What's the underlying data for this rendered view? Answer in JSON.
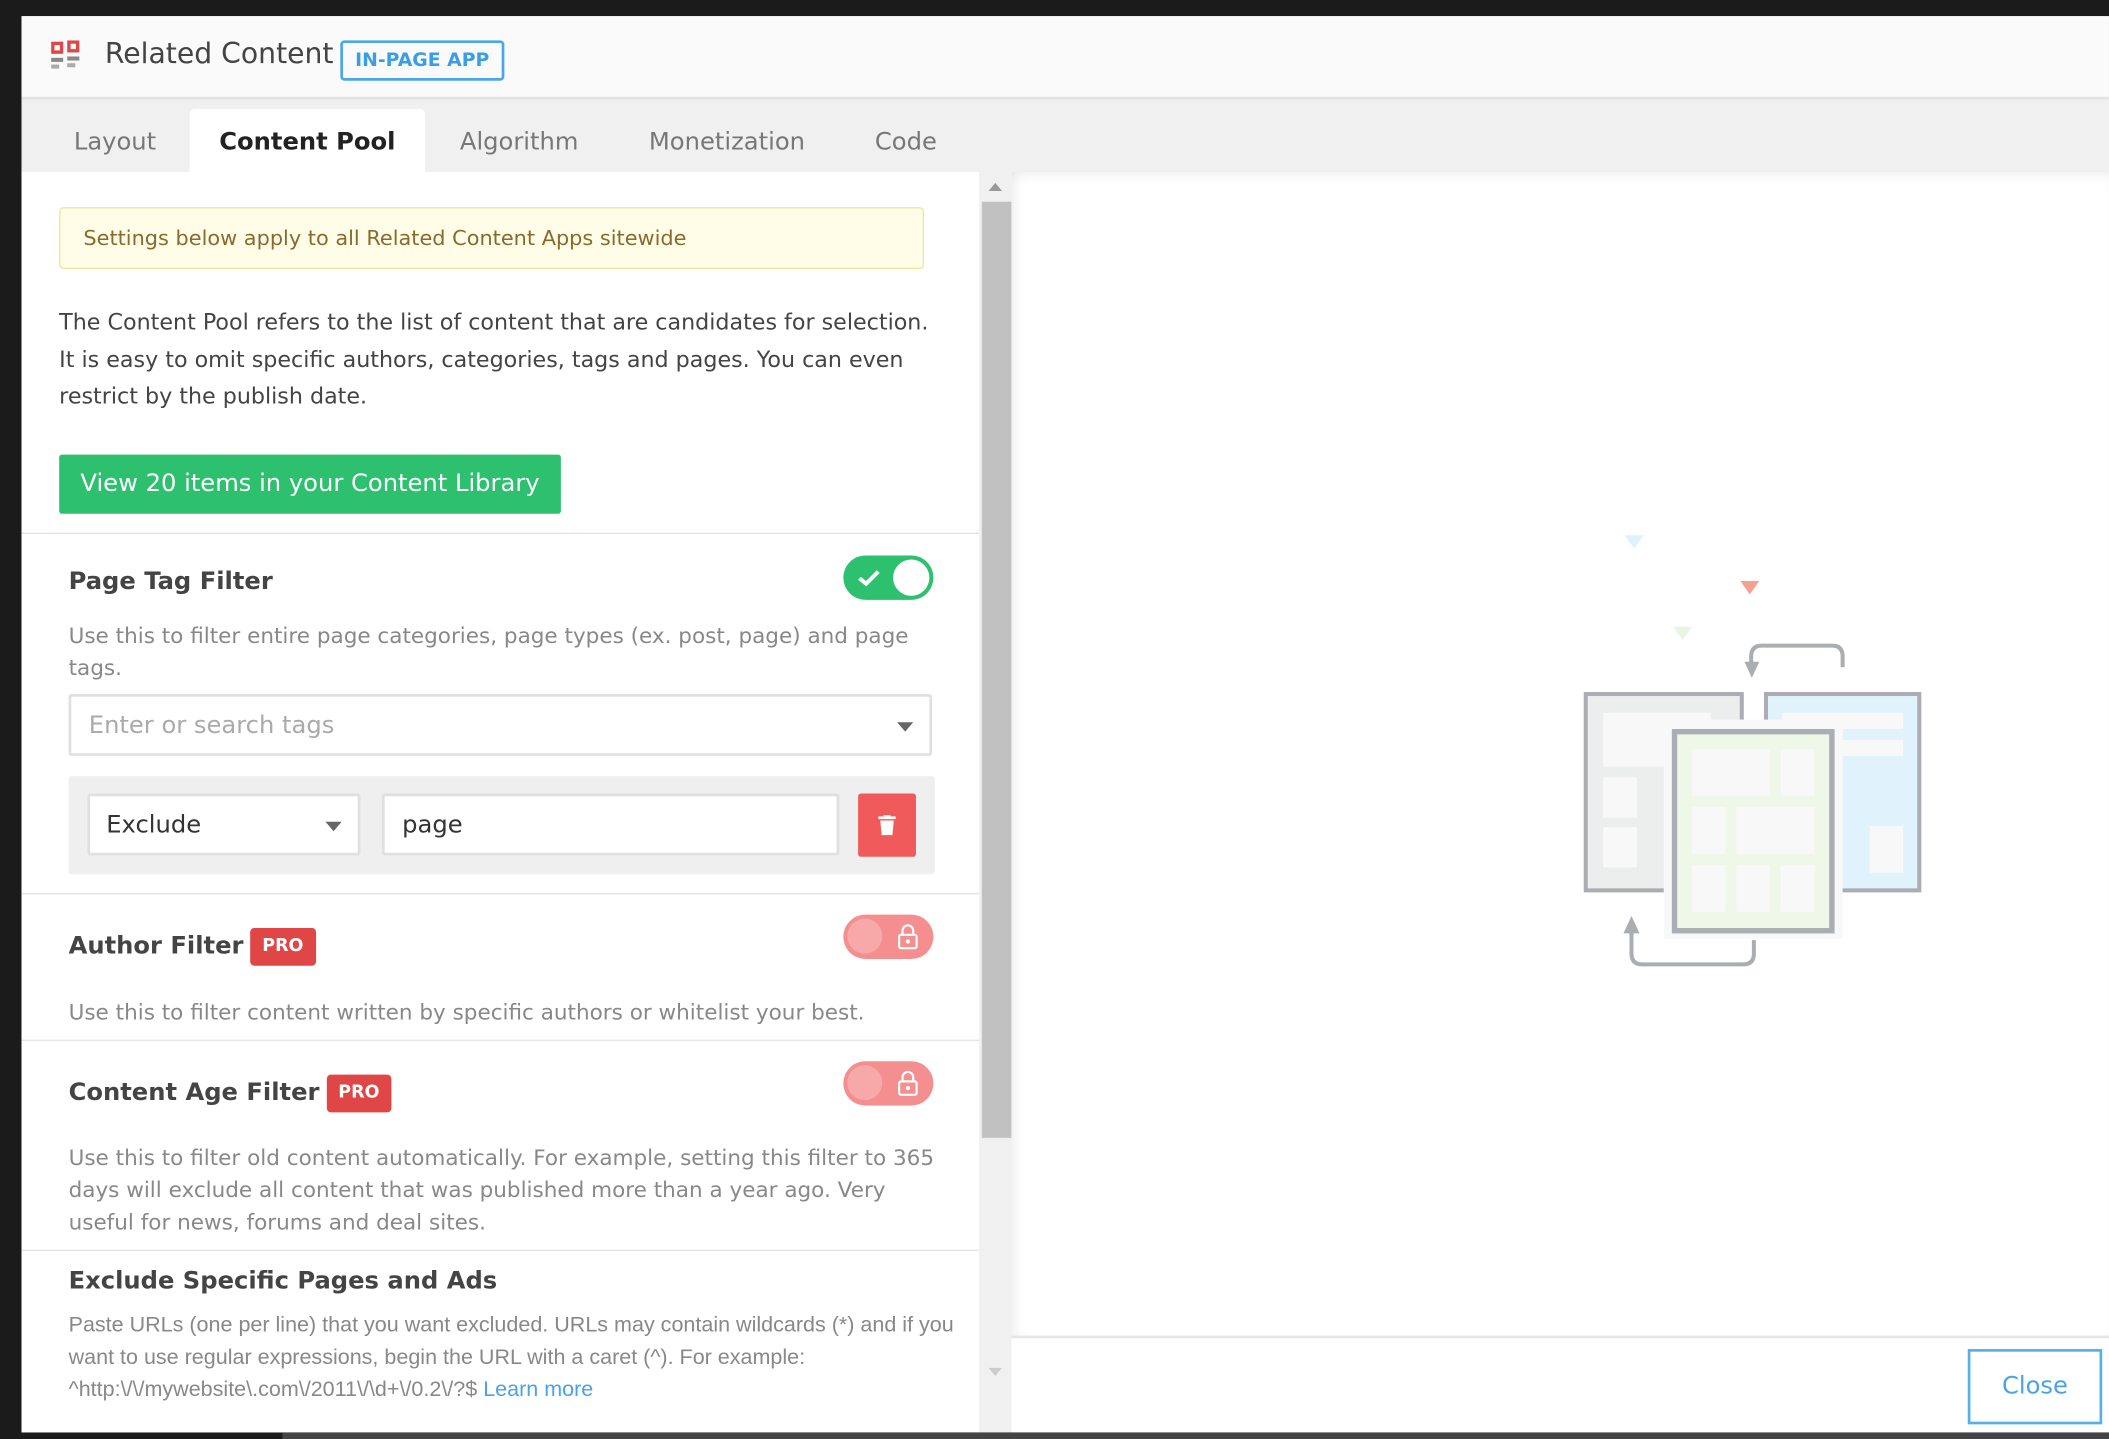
{
  "header": {
    "title": "Related Content",
    "badge": "IN-PAGE APP"
  },
  "tabs": [
    {
      "label": "Layout"
    },
    {
      "label": "Content Pool"
    },
    {
      "label": "Algorithm"
    },
    {
      "label": "Monetization"
    },
    {
      "label": "Code"
    }
  ],
  "active_tab": "Content Pool",
  "notice": "Settings below apply to all Related Content Apps sitewide",
  "intro": "The Content Pool refers to the list of content that are candidates for selection. It is easy to omit specific authors, categories, tags and pages. You can even restrict by the publish date.",
  "library_button": "View 20 items in your Content Library",
  "page_tag_filter": {
    "title": "Page Tag Filter",
    "enabled": true,
    "description": "Use this to filter entire page categories, page types (ex. post, page) and page tags.",
    "search_placeholder": "Enter or search tags",
    "rule": {
      "mode": "Exclude",
      "value": "page"
    }
  },
  "author_filter": {
    "title": "Author Filter",
    "badge": "PRO",
    "enabled": false,
    "locked": true,
    "description": "Use this to filter content written by specific authors or whitelist your best."
  },
  "content_age_filter": {
    "title": "Content Age Filter",
    "badge": "PRO",
    "enabled": false,
    "locked": true,
    "description": "Use this to filter old content automatically. For example, setting this filter to 365 days will exclude all content that was published more than a year ago. Very useful for news, forums and deal sites."
  },
  "exclude_pages": {
    "title": "Exclude Specific Pages and Ads",
    "description": "Paste URLs (one per line) that you want excluded. URLs may contain wildcards (*) and if you want to use regular expressions, begin the URL with a caret (^). For example: ^http:\\/\\/mywebsite\\.com\\/2011\\/\\d+\\/0.2\\/?$",
    "learn_more": "Learn more"
  },
  "footer": {
    "close": "Close"
  },
  "colors": {
    "accent": "#2dc06f",
    "pro": "#e04646",
    "link": "#4aa3e6",
    "delete": "#f05a5a"
  }
}
